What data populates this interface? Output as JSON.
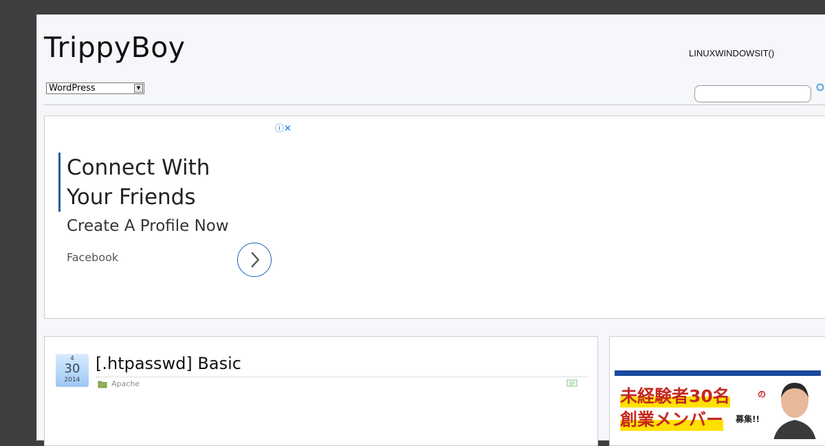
{
  "site": {
    "title": "TrippyBoy",
    "nav_text": "LINUXWINDOWSIT()"
  },
  "category_select": {
    "selected": "WordPress"
  },
  "search": {
    "value": "",
    "placeholder": ""
  },
  "ad": {
    "headline_line1": "Connect With",
    "headline_line2": "Your Friends",
    "subheadline": "Create A Profile Now",
    "source": "Facebook",
    "close_glyph": "ⓘ✕"
  },
  "post": {
    "date_month": "4",
    "date_day": "30",
    "date_year": "2014",
    "title": "[.htpasswd] Basic",
    "category": "Apache"
  },
  "sidebar_banner": {
    "line1": "未経験者30名",
    "line1_suffix": "の",
    "line2": "創業メンバー",
    "line2_suffix": "募集!!"
  },
  "colors": {
    "page_bg": "#f5f7fb",
    "outer_bg": "#3f3f3f",
    "accent_blue": "#1a5fb4",
    "banner_red": "#c5271f",
    "banner_yellow": "#ffe100"
  }
}
